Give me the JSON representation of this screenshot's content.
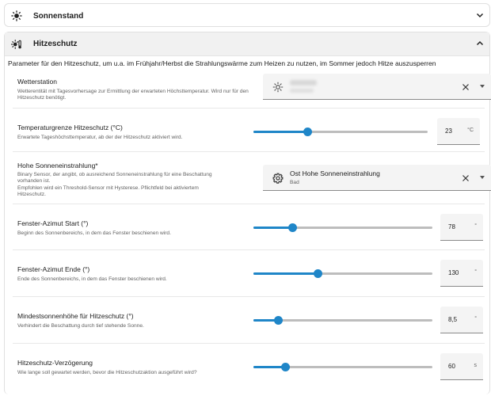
{
  "panels": {
    "sonnenstand": {
      "title": "Sonnenstand",
      "icon": "sun-icon",
      "expanded": false
    },
    "hitzeschutz": {
      "title": "Hitzeschutz",
      "icon": "sun-thermometer-icon",
      "expanded": true,
      "description": "Parameter für den Hitzeschutz, um u.a. im Frühjahr/Herbst die Strahlungswärme zum Heizen zu nutzen, im Sommer jedoch Hitze auszusperren"
    }
  },
  "fields": {
    "wetterstation": {
      "label": "Wetterstation",
      "help": "Wetterentität mit Tagesvorhersage zur Ermittlung der erwarteten Höchsttemperatur. Wird nur für den Hitzeschutz benötigt.",
      "icon": "weather-sunny-icon",
      "value_redacted": true
    },
    "temperaturgrenze": {
      "label": "Temperaturgrenze Hitzeschutz (°C)",
      "help": "Erwartete Tageshöchsttemperatur, ab der der Hitzeschutz aktiviert wird.",
      "value": "23",
      "unit": "°C",
      "slider_fraction": 0.31
    },
    "hohe_sonneneinstrahlung": {
      "label": "Hohe Sonneneinstrahlung*",
      "help_lines": [
        "Binary Sensor, der angibt, ob ausreichend Sonneneinstrahlung für eine Beschattung",
        "vorhanden ist.",
        "Empfohlen wird ein Threshold-Sensor mit Hysterese. Pflichtfeld bei aktiviertem",
        "Hitzeschutz."
      ],
      "entity_name": "Ost Hohe Sonneneinstrahlung",
      "entity_area": "Bad",
      "icon": "gear-icon"
    },
    "azimut_start": {
      "label": "Fenster-Azimut Start (°)",
      "help": "Beginn des Sonnenbereichs, in dem das Fenster beschienen wird.",
      "value": "78",
      "unit": "°",
      "slider_fraction": 0.22
    },
    "azimut_ende": {
      "label": "Fenster-Azimut Ende (°)",
      "help": "Ende des Sonnenbereichs, in dem das Fenster beschienen wird.",
      "value": "130",
      "unit": "°",
      "slider_fraction": 0.36
    },
    "mindestsonnenhoehe": {
      "label": "Mindestsonnenhöhe für Hitzeschutz (°)",
      "help": "Verhindert die Beschattung durch tief stehende Sonne.",
      "value": "8,5",
      "unit": "°",
      "slider_fraction": 0.14
    },
    "verzoegerung": {
      "label": "Hitzeschutz-Verzögerung",
      "help": "Wie lange soll gewartet werden, bevor die Hitzeschutzaktion ausgeführt wird?",
      "value": "60",
      "unit": "s",
      "slider_fraction": 0.18
    }
  },
  "colors": {
    "accent": "#1f86c8",
    "track": "#bdbdbd",
    "field_bg": "#f4f4f4"
  }
}
